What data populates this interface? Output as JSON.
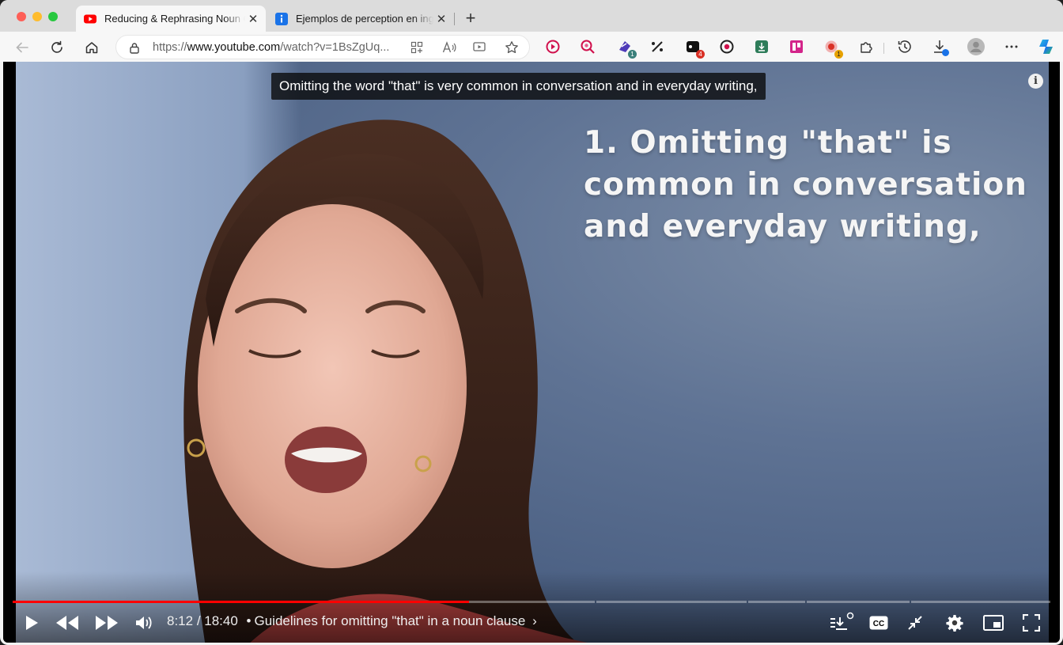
{
  "tabs": [
    {
      "title": "Reducing & Rephrasing Noun Clauses",
      "active": true
    },
    {
      "title": "Ejemplos de perception en inglés",
      "active": false
    }
  ],
  "new_tab": "+",
  "tab_close": "✕",
  "address": {
    "prefix": "https://",
    "host": "www.youtube.com",
    "path": "/watch?v=1BsZgUq..."
  },
  "extensions": [
    {
      "name": "youtube-ext",
      "badge": ""
    },
    {
      "name": "search-ext",
      "badge": ""
    },
    {
      "name": "ext-purple",
      "badge": "1"
    },
    {
      "name": "ext-dots",
      "badge": ""
    },
    {
      "name": "ext-dark",
      "badge": "4"
    },
    {
      "name": "ext-record",
      "badge": ""
    },
    {
      "name": "ext-green",
      "badge": ""
    },
    {
      "name": "ext-trello",
      "badge": ""
    },
    {
      "name": "ext-red",
      "badge": "1"
    }
  ],
  "video": {
    "caption": "Omitting the word \"that\" is very common in conversation and in everyday writing,",
    "slide_lines": [
      "1. Omitting \"that\" is",
      "common in conversation",
      "and everyday writing,"
    ],
    "info": "i",
    "time_current": "8:12",
    "time_total": "18:40",
    "time_sep": " / ",
    "chapter_bullet": "•",
    "chapter": "Guidelines for omitting \"that\" in a noun clause",
    "chapter_chevron": "›",
    "played_fraction": 0.44
  },
  "colors": {
    "accent": "#ff0000",
    "caption_bg": "#080808"
  }
}
